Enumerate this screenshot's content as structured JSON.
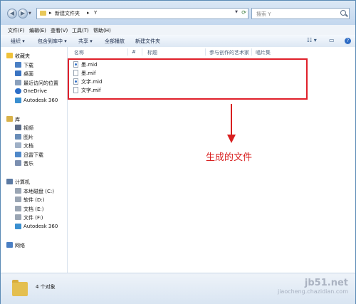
{
  "address": {
    "crumbs": [
      "新建文件夹",
      "Y"
    ],
    "search_placeholder": "搜索 Y"
  },
  "menu": [
    "文件(F)",
    "编辑(E)",
    "查看(V)",
    "工具(T)",
    "帮助(H)"
  ],
  "toolbar": {
    "organize": "组织 ▾",
    "include_in_library": "包含到库中 ▾",
    "share": "共享 ▾",
    "play_all": "全部播放",
    "new_folder": "新建文件夹"
  },
  "nav": {
    "favorites": "收藏夹",
    "downloads": "下载",
    "desktop": "桌面",
    "recent": "最近访问的位置",
    "onedrive": "OneDrive",
    "autodesk1": "Autodesk 360",
    "library": "库",
    "video": "视频",
    "pictures": "图片",
    "documents": "文档",
    "thunder": "迅雷下载",
    "music": "音乐",
    "computer": "计算机",
    "drive_c": "本地磁盘 (C:)",
    "drive_d": "软件 (D:)",
    "drive_e": "文档 (E:)",
    "drive_f": "文件 (F:)",
    "autodesk2": "Autodesk 360",
    "network": "网络"
  },
  "columns": [
    "名称",
    "#",
    "标题",
    "参与创作的艺术家",
    "唱片集"
  ],
  "files": [
    {
      "name": "墨.mid",
      "type": "mid"
    },
    {
      "name": "墨.mif",
      "type": "mif"
    },
    {
      "name": "文字.mid",
      "type": "mid"
    },
    {
      "name": "文字.mif",
      "type": "mif"
    }
  ],
  "annotation": "生成的文件",
  "status": "4 个对象",
  "watermark": {
    "line1": "jb51.net",
    "line2": "jiaocheng.chazidian.com"
  },
  "colors": {
    "highlight": "#e0202a",
    "arrow": "#d82020"
  }
}
